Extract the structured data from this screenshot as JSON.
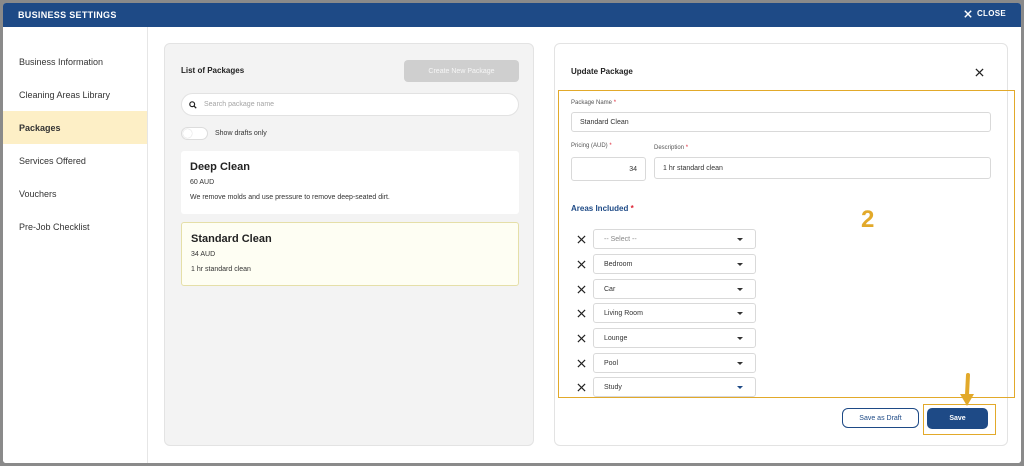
{
  "window": {
    "title": "BUSINESS SETTINGS",
    "close_label": "CLOSE"
  },
  "sidebar": {
    "items": [
      {
        "label": "Business Information"
      },
      {
        "label": "Cleaning Areas Library"
      },
      {
        "label": "Packages",
        "active": true
      },
      {
        "label": "Services Offered"
      },
      {
        "label": "Vouchers"
      },
      {
        "label": "Pre-Job Checklist"
      }
    ]
  },
  "packages": {
    "title": "List of Packages",
    "create_label": "Create New Package",
    "search_placeholder": "Search package name",
    "drafts_toggle_label": "Show drafts only",
    "drafts_only": false,
    "items": [
      {
        "name": "Deep Clean",
        "price": "60 AUD",
        "description": "We remove molds and use pressure to remove deep-seated dirt."
      },
      {
        "name": "Standard Clean",
        "price": "34 AUD",
        "description": "1 hr standard clean",
        "selected": true
      }
    ]
  },
  "update": {
    "title": "Update Package",
    "name_label": "Package Name",
    "name_value": "Standard Clean",
    "pricing_label": "Pricing (AUD)",
    "pricing_value": "34",
    "description_label": "Description",
    "description_value": "1 hr standard clean",
    "required_mark": "*",
    "areas_title": "Areas Included",
    "areas": [
      {
        "value": "-- Select --",
        "placeholder": true
      },
      {
        "value": "Bedroom"
      },
      {
        "value": "Car"
      },
      {
        "value": "Living Room"
      },
      {
        "value": "Lounge"
      },
      {
        "value": "Pool"
      },
      {
        "value": "Study"
      }
    ],
    "draft_label": "Save as Draft",
    "save_label": "Save"
  },
  "annotations": {
    "step_number": "2",
    "highlight_color": "#e2a92a"
  },
  "colors": {
    "brand": "#1e4a86",
    "active_item": "#fdefc6",
    "required": "#d22233"
  }
}
